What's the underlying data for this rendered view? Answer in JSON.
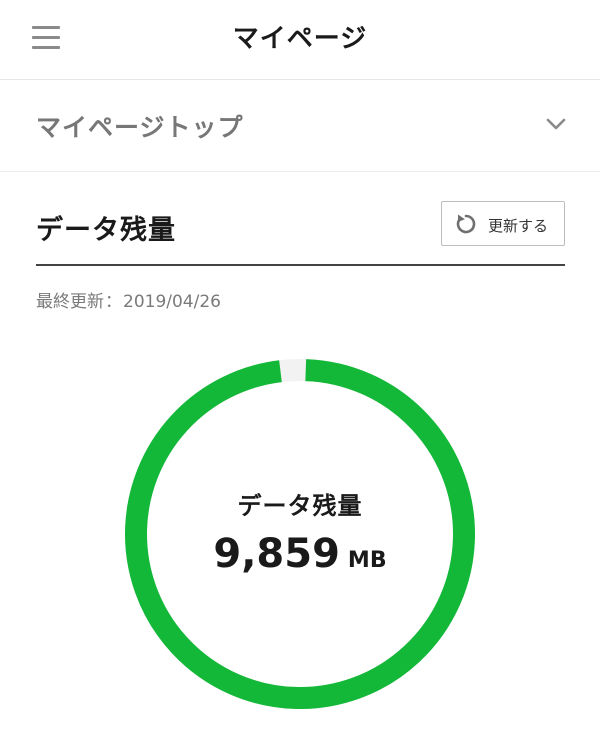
{
  "header": {
    "title": "マイページ",
    "menu_icon": "hamburger-menu-icon"
  },
  "section_select": {
    "label": "マイページトップ",
    "icon": "chevron-down-icon"
  },
  "data_remaining": {
    "title": "データ残量",
    "refresh_label": "更新する",
    "refresh_icon": "refresh-icon",
    "last_updated_label": "最終更新",
    "last_updated_sep": "：",
    "last_updated_date": "2019/04/26"
  },
  "gauge": {
    "label": "データ残量",
    "value": "9,859",
    "unit": "MB",
    "remaining_fraction": 0.975,
    "color_fill": "#14b839",
    "color_track": "#f2f2f2"
  }
}
